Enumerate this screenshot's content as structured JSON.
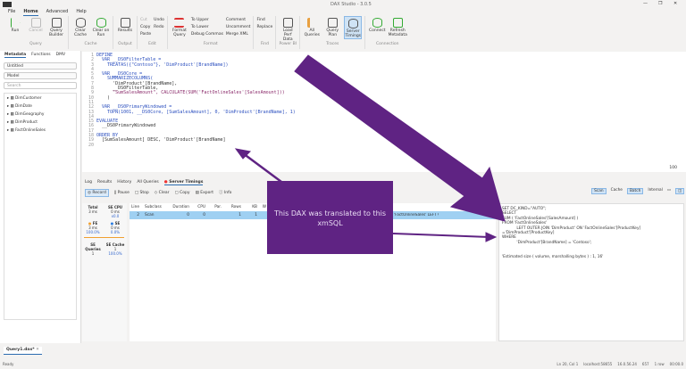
{
  "window": {
    "title": "DAX Studio - 3.0.5",
    "controls": [
      "—",
      "❐",
      "✕"
    ]
  },
  "menu": [
    "File",
    "Home",
    "Advanced",
    "Help"
  ],
  "ribbon": {
    "groups": [
      {
        "label": "Query",
        "buttons": [
          "Run",
          "Cancel",
          "Query Builder"
        ]
      },
      {
        "label": "Cache",
        "buttons": [
          "Clear Cache",
          "Clear on Run"
        ]
      },
      {
        "label": "Output",
        "buttons": [
          "Results"
        ]
      },
      {
        "label": "Edit",
        "small": [
          "Cut",
          "Copy",
          "Paste",
          "Undo",
          "Redo"
        ]
      },
      {
        "label": "Format",
        "buttons": [
          "Format Query"
        ],
        "small": [
          "To Upper",
          "To Lower",
          "Debug Commas",
          "Comment",
          "Uncomment",
          "Merge XML"
        ]
      },
      {
        "label": "Find",
        "small": [
          "Find",
          "Replace"
        ]
      },
      {
        "label": "Power BI",
        "buttons": [
          "Load Perf Data"
        ]
      },
      {
        "label": "Traces",
        "buttons": [
          "All Queries",
          "Query Plan",
          "Server Timings"
        ]
      },
      {
        "label": "Connection",
        "buttons": [
          "Connect",
          "Refresh Metadata"
        ]
      }
    ],
    "selected": "Server Timings"
  },
  "left": {
    "tabs": [
      "Metadata",
      "Functions",
      "DMV"
    ],
    "database": "Untitled",
    "model": "Model",
    "search_placeholder": "Search",
    "tables": [
      "DimCustomer",
      "DimDate",
      "DimGeography",
      "DimProduct",
      "FactOnlineSales"
    ]
  },
  "editor": {
    "zoom": "100",
    "lines": [
      "DEFINE",
      "  VAR __DS0FilterTable =",
      "    TREATAS({\"Contoso\"}, 'DimProduct'[BrandName])",
      "",
      "  VAR __DS0Core =",
      "    SUMMARIZECOLUMNS(",
      "      'DimProduct'[BrandName],",
      "      __DS0FilterTable,",
      "      \"SumSalesAmount\", CALCULATE(SUM('FactOnlineSales'[SalesAmount]))",
      "    )",
      "",
      "  VAR __DS0PrimaryWindowed =",
      "    TOPN(1001, __DS0Core, [SumSalesAmount], 0, 'DimProduct'[BrandName], 1)",
      "",
      "EVALUATE",
      "  __DS0PrimaryWindowed",
      "",
      "ORDER BY",
      "  [SumSalesAmount] DESC, 'DimProduct'[BrandName]",
      ""
    ]
  },
  "bottom": {
    "tabs": [
      "Log",
      "Results",
      "History",
      "All Queries",
      "Server Timings"
    ],
    "active_tab": "Server Timings",
    "toolbar": [
      "Record",
      "Pause",
      "Stop",
      "Clear",
      "Copy",
      "Export",
      "Info"
    ],
    "summary": {
      "total_label": "Total",
      "total": "3 ms",
      "secpu_label": "SE CPU",
      "secpu": "0 ms",
      "secpu_ratio": "x0.0",
      "fe_label": "FE",
      "fe": "3 ms",
      "fe_pct": "100.0%",
      "se_label": "SE",
      "se": "0 ms",
      "se_pct": "0.0%",
      "seq_label": "SE Queries",
      "seq": "1",
      "sec_label": "SE Cache",
      "sec": "1",
      "sec_pct": "100.0%"
    },
    "grid": {
      "columns": [
        "Line",
        "Subclass",
        "Duration",
        "CPU",
        "Par.",
        "Rows",
        "KB",
        "W"
      ],
      "rows": [
        {
          "line": "2",
          "subclass": "Scan",
          "duration": "0",
          "cpu": "0",
          "par": "",
          "rows": "1",
          "kb": "1",
          "query": "'FactOnlineSales' LEFT OUTER JOIN"
        }
      ]
    },
    "filters": [
      "Scan",
      "Cache",
      "Batch",
      "Internal"
    ],
    "xmsql": "SET DC_KIND=\"AUTO\";\nSELECT\nSUM ( 'FactOnlineSales'[SalesAmount] )\nFROM 'FactOnlineSales'\n            LEFT OUTER JOIN 'DimProduct' ON 'FactOnlineSales'[ProductKey]\n='DimProduct'[ProductKey]\nWHERE\n            'DimProduct'[BrandName] = 'Contoso';\n\n\n'Estimated size ( volume, marshalling bytes ) : 1, 16'"
  },
  "callout": {
    "text": "This DAX was translated to this xmSQL",
    "color": "#5f2383"
  },
  "doc_tab": "Query1.dax*",
  "status": {
    "left": "Ready",
    "position": "Ln 20, Col 1",
    "server": "localhost:58655",
    "version": "16.0.56.24",
    "spid": "657",
    "rows": "1 row",
    "time": "00:00.0"
  }
}
